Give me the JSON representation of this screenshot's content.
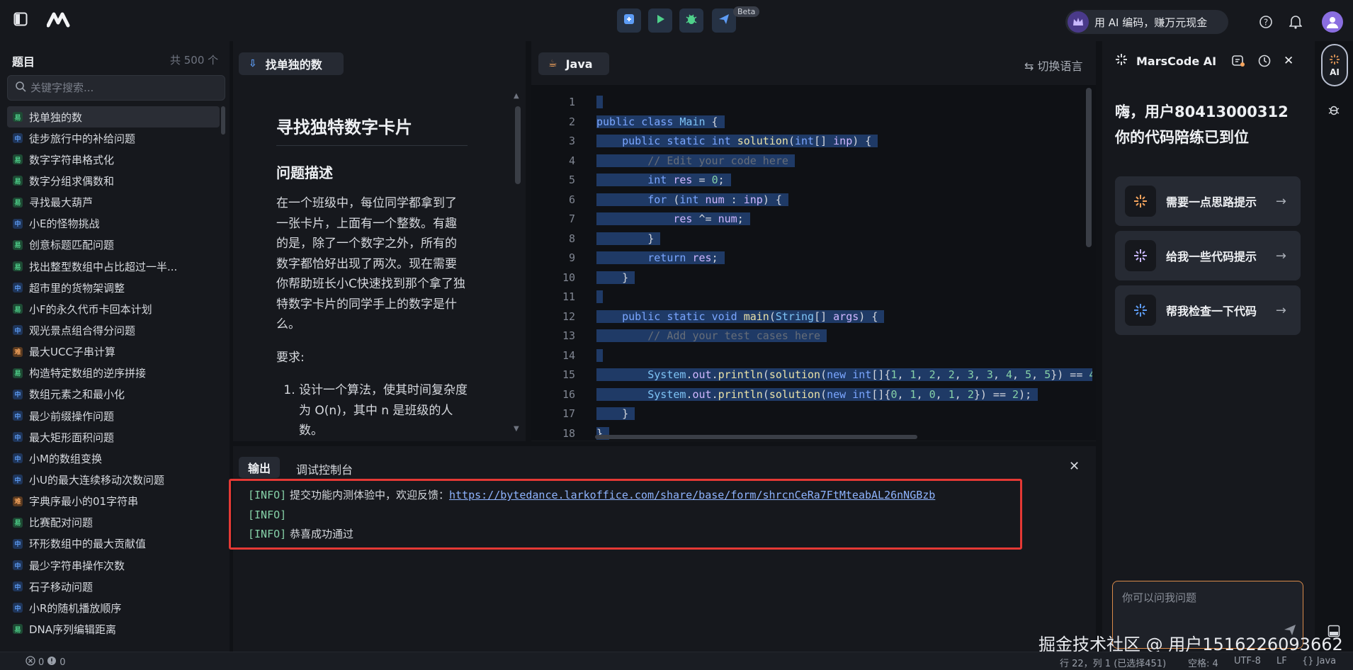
{
  "topbar": {
    "beta_label": "Beta",
    "promo_label": "用 AI 编码，赚万元现金"
  },
  "problem_list": {
    "title": "题目",
    "count": "共 500 个",
    "search_placeholder": "关键字搜索...",
    "items": [
      {
        "level": "易",
        "title": "找单独的数",
        "active": true
      },
      {
        "level": "中",
        "title": "徒步旅行中的补给问题"
      },
      {
        "level": "易",
        "title": "数字字符串格式化"
      },
      {
        "level": "易",
        "title": "数字分组求偶数和"
      },
      {
        "level": "易",
        "title": "寻找最大葫芦"
      },
      {
        "level": "中",
        "title": "小E的怪物挑战"
      },
      {
        "level": "易",
        "title": "创意标题匹配问题"
      },
      {
        "level": "易",
        "title": "找出整型数组中占比超过一半..."
      },
      {
        "level": "中",
        "title": "超市里的货物架调整"
      },
      {
        "level": "易",
        "title": "小F的永久代币卡回本计划"
      },
      {
        "level": "中",
        "title": "观光景点组合得分问题"
      },
      {
        "level": "难",
        "title": "最大UCC子串计算"
      },
      {
        "level": "易",
        "title": "构造特定数组的逆序拼接"
      },
      {
        "level": "中",
        "title": "数组元素之和最小化"
      },
      {
        "level": "中",
        "title": "最少前缀操作问题"
      },
      {
        "level": "中",
        "title": "最大矩形面积问题"
      },
      {
        "level": "中",
        "title": "小M的数组变换"
      },
      {
        "level": "中",
        "title": "小U的最大连续移动次数问题"
      },
      {
        "level": "难",
        "title": "字典序最小的01字符串"
      },
      {
        "level": "易",
        "title": "比赛配对问题"
      },
      {
        "level": "中",
        "title": "环形数组中的最大贡献值"
      },
      {
        "level": "中",
        "title": "最少字符串操作次数"
      },
      {
        "level": "中",
        "title": "石子移动问题"
      },
      {
        "level": "中",
        "title": "小R的随机播放顺序"
      },
      {
        "level": "易",
        "title": "DNA序列编辑距离"
      }
    ]
  },
  "problem": {
    "tab_label": "找单独的数",
    "heading": "寻找独特数字卡片",
    "section_title": "问题描述",
    "description": "在一个班级中，每位同学都拿到了一张卡片，上面有一个整数。有趣的是，除了一个数字之外，所有的数字都恰好出现了两次。现在需要你帮助班长小C快速找到那个拿了独特数字卡片的同学手上的数字是什么。",
    "requirements_label": "要求:",
    "requirement_1": "设计一个算法，使其时间复杂度为 O(n)，其中 n 是班级的人数。"
  },
  "editor": {
    "language_tab": "Java",
    "switch_language": "切换语言",
    "line_numbers": [
      "1",
      "2",
      "3",
      "4",
      "5",
      "6",
      "7",
      "8",
      "9",
      "10",
      "11",
      "12",
      "13",
      "14",
      "15",
      "16",
      "17",
      "18"
    ]
  },
  "output": {
    "tab_output": "输出",
    "tab_console": "调试控制台",
    "lines": [
      {
        "tag": "[INFO]",
        "text": "提交功能内测体验中，欢迎反馈：",
        "link": "https://bytedance.larkoffice.com/share/base/form/shrcnCeRa7FtMteabAL26nNGBzb"
      },
      {
        "tag": "[INFO]",
        "text": "",
        "link": ""
      },
      {
        "tag": "[INFO]",
        "text": "恭喜成功通过",
        "link": ""
      }
    ]
  },
  "ai": {
    "title": "MarsCode AI",
    "greeting_line1": "嗨，用户80413000312",
    "greeting_line2": "你的代码陪练已到位",
    "cards": [
      {
        "label": "需要一点思路提示"
      },
      {
        "label": "给我一些代码提示"
      },
      {
        "label": "帮我检查一下代码"
      }
    ],
    "input_placeholder": "你可以问我问题",
    "rail_label": "AI"
  },
  "statusbar": {
    "errors": "0",
    "warnings": "0",
    "position": "行 22，列 1 (已选择451)",
    "spaces": "空格: 4",
    "encoding": "UTF-8",
    "eol": "LF",
    "language": "Java"
  },
  "watermark": "掘金技术社区 @ 用户1516226093662",
  "colors": {
    "accent_blue": "#5d9cf5",
    "easy_green": "#4fd18b",
    "hard_orange": "#f5a45d",
    "highlight_red": "#e53935"
  }
}
